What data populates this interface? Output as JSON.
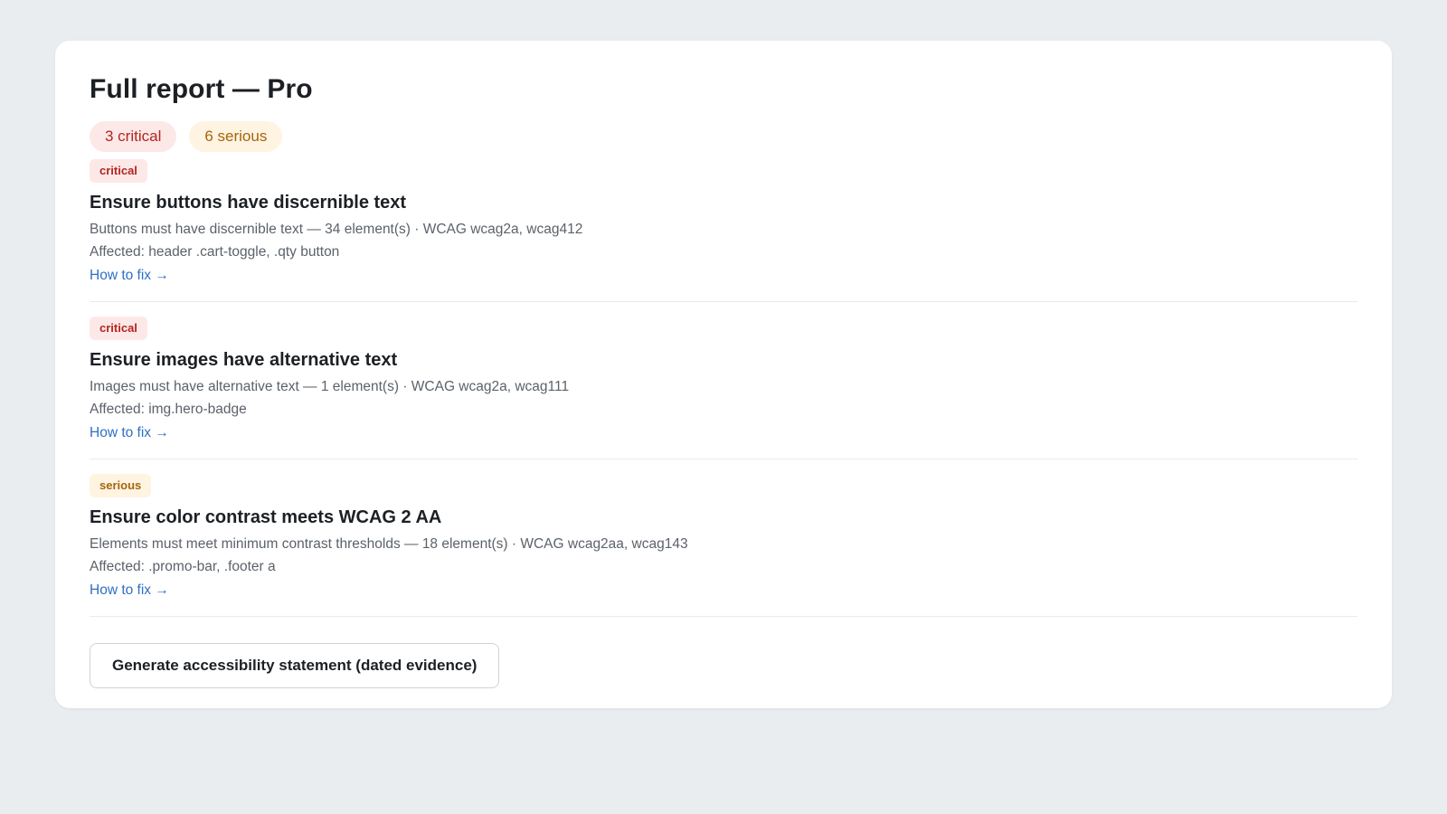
{
  "report": {
    "title": "Full report — Pro"
  },
  "summary": {
    "critical_label": "3 critical",
    "serious_label": "6 serious"
  },
  "issues": [
    {
      "severity": "critical",
      "title": "Ensure buttons have discernible text",
      "meta": "Buttons must have discernible text — 34 element(s) · WCAG wcag2a, wcag412",
      "affected": "Affected: header .cart-toggle, .qty button",
      "link": "How to fix →"
    },
    {
      "severity": "critical",
      "title": "Ensure images have alternative text",
      "meta": "Images must have alternative text — 1 element(s) · WCAG wcag2a, wcag111",
      "affected": "Affected: img.hero-badge",
      "link": "How to fix →"
    },
    {
      "severity": "serious",
      "title": "Ensure color contrast meets WCAG 2 AA",
      "meta": "Elements must meet minimum contrast thresholds — 18 element(s) · WCAG wcag2aa, wcag143",
      "affected": "Affected: .promo-bar, .footer a",
      "link": "How to fix →"
    }
  ],
  "actions": {
    "statement_button": "Generate accessibility statement (dated evidence)"
  },
  "colors": {
    "page_background": "#e9edf0",
    "critical_text": "#b3261e",
    "critical_bg": "#fde8e8",
    "serious_text": "#a5660a",
    "serious_bg": "#fff3e2",
    "link": "#2f6fc4"
  }
}
